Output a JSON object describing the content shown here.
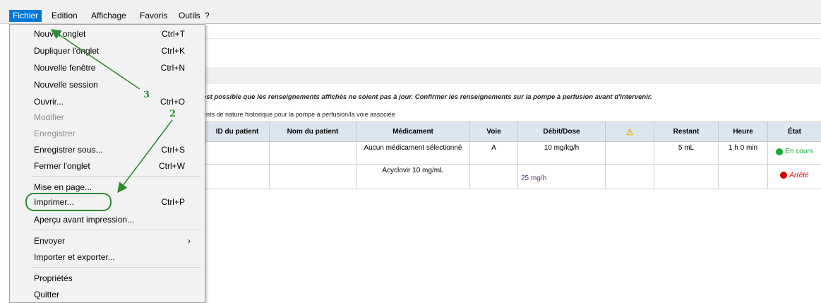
{
  "menubar": {
    "items": [
      {
        "label": "Fichier",
        "active": true
      },
      {
        "label": "Edition"
      },
      {
        "label": "Affichage"
      },
      {
        "label": "Favoris"
      },
      {
        "label": "Outils"
      },
      {
        "label": "?"
      }
    ]
  },
  "dropdown": {
    "items": [
      {
        "label": "Nouvel onglet",
        "shortcut": "Ctrl+T"
      },
      {
        "label": "Dupliquer l'onglet",
        "shortcut": "Ctrl+K"
      },
      {
        "label": "Nouvelle fenêtre",
        "shortcut": "Ctrl+N"
      },
      {
        "label": "Nouvelle session",
        "shortcut": ""
      },
      {
        "label": "Ouvrir...",
        "shortcut": "Ctrl+O"
      },
      {
        "label": "Modifier",
        "shortcut": "",
        "disabled": true
      },
      {
        "label": "Enregistrer",
        "shortcut": "",
        "disabled": true
      },
      {
        "label": "Enregistrer sous...",
        "shortcut": "Ctrl+S"
      },
      {
        "label": "Fermer l'onglet",
        "shortcut": "Ctrl+W"
      },
      {
        "label": "Mise en page...",
        "shortcut": ""
      },
      {
        "label": "Imprimer...",
        "shortcut": "Ctrl+P",
        "highlighted": true
      },
      {
        "label": "Aperçu avant impression...",
        "shortcut": ""
      },
      {
        "label": "Envoyer",
        "shortcut": "",
        "submenu": "›"
      },
      {
        "label": "Importer et exporter...",
        "shortcut": ""
      },
      {
        "label": "Propriétés",
        "shortcut": ""
      },
      {
        "label": "Quitter",
        "shortcut": ""
      }
    ]
  },
  "annotations": {
    "step2": "2",
    "step3": "3"
  },
  "page": {
    "warning": "est possible que les renseignements affichés ne soient pas à jour. Confirmer les renseignements sur la pompe à perfusion avant d'intervenir.",
    "history_note": "ents de nature historique pour la pompe à perfusion/la voie associée"
  },
  "table": {
    "headers": [
      "ID du patient",
      "Nom du patient",
      "Médicament",
      "Voie",
      "Débit/Dose",
      "⚠",
      "Restant",
      "Heure",
      "État"
    ],
    "rows": [
      {
        "cells": [
          "",
          "",
          "Aucun médicament sélectionné",
          "A",
          "10 mg/kg/h",
          "",
          "5 mL",
          "1 h 0 min"
        ],
        "status": "En cours"
      },
      {
        "cells": [
          "",
          "",
          "Acyclovir 10 mg/mL",
          "",
          "25 mg/h",
          "",
          "",
          ""
        ],
        "status": "Arrêté"
      }
    ]
  },
  "colors": {
    "running": "#1aa830",
    "stopped": "#d80000",
    "annotation": "#2e8b2e",
    "menu_active": "#0078d7"
  }
}
